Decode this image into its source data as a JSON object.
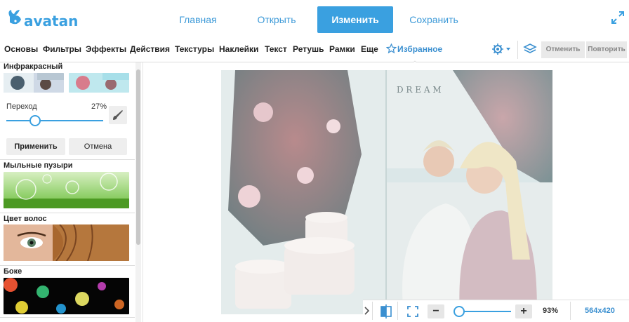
{
  "header": {
    "logo_text": "avatan",
    "nav": {
      "home": "Главная",
      "open": "Открыть",
      "edit": "Изменить",
      "save": "Сохранить"
    }
  },
  "menu": {
    "items": [
      "Основы",
      "Фильтры",
      "Эффекты",
      "Действия",
      "Текстуры",
      "Наклейки",
      "Текст",
      "Ретушь",
      "Рамки",
      "Еще"
    ],
    "favorites": "Избранное",
    "undo": "Отменить",
    "redo": "Повторить"
  },
  "sidebar": {
    "infrared": {
      "title": "Инфракрасный",
      "transition_label": "Переход",
      "transition_value": "27%",
      "apply": "Применить",
      "cancel": "Отмена"
    },
    "effects": [
      {
        "title": "Мыльные пузыри"
      },
      {
        "title": "Цвет волос"
      },
      {
        "title": "Боке"
      }
    ]
  },
  "zoom": {
    "value": "93%",
    "dimensions": "564x420"
  },
  "colors": {
    "accent": "#3aa0e0",
    "link": "#3d9ad8"
  }
}
